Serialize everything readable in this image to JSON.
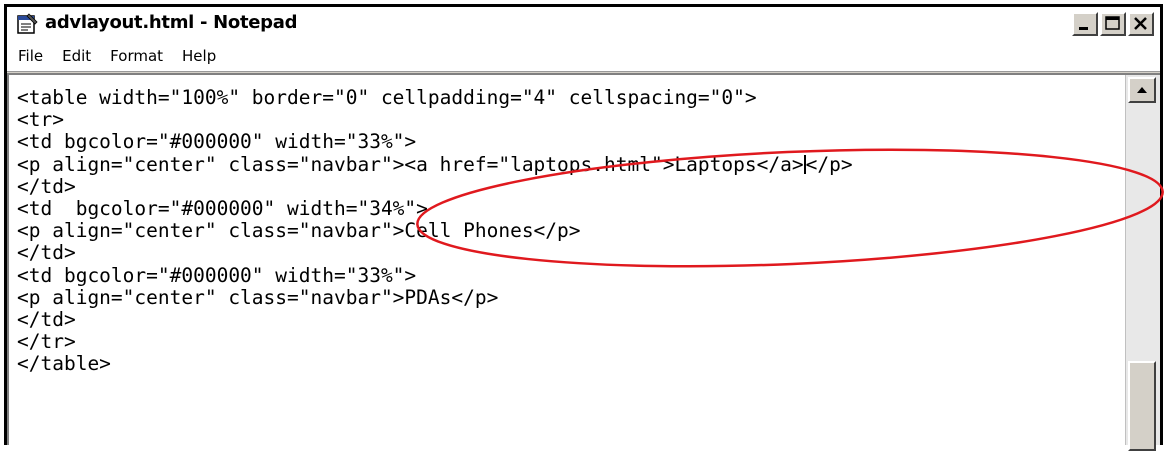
{
  "window": {
    "title": "advlayout.html - Notepad",
    "icon": "notepad-icon"
  },
  "menu": {
    "items": [
      "File",
      "Edit",
      "Format",
      "Help"
    ]
  },
  "editor": {
    "lines": [
      "<table width=\"100%\" border=\"0\" cellpadding=\"4\" cellspacing=\"0\">",
      "<tr>",
      "<td bgcolor=\"#000000\" width=\"33%\">",
      "<p align=\"center\" class=\"navbar\"><a href=\"laptops.html\">Laptops</a>",
      "</td>",
      "<td  bgcolor=\"#000000\" width=\"34%\">",
      "<p align=\"center\" class=\"navbar\">Cell Phones</p>",
      "</td>",
      "<td bgcolor=\"#000000\" width=\"33%\">",
      "<p align=\"center\" class=\"navbar\">PDAs</p>",
      "</td>",
      "</tr>",
      "</table>"
    ],
    "line4_after_caret": "</p>"
  },
  "colors": {
    "annotation": "#e0191e",
    "titlebar_bg": "#ffffff",
    "chrome": "#d4d0c8"
  }
}
